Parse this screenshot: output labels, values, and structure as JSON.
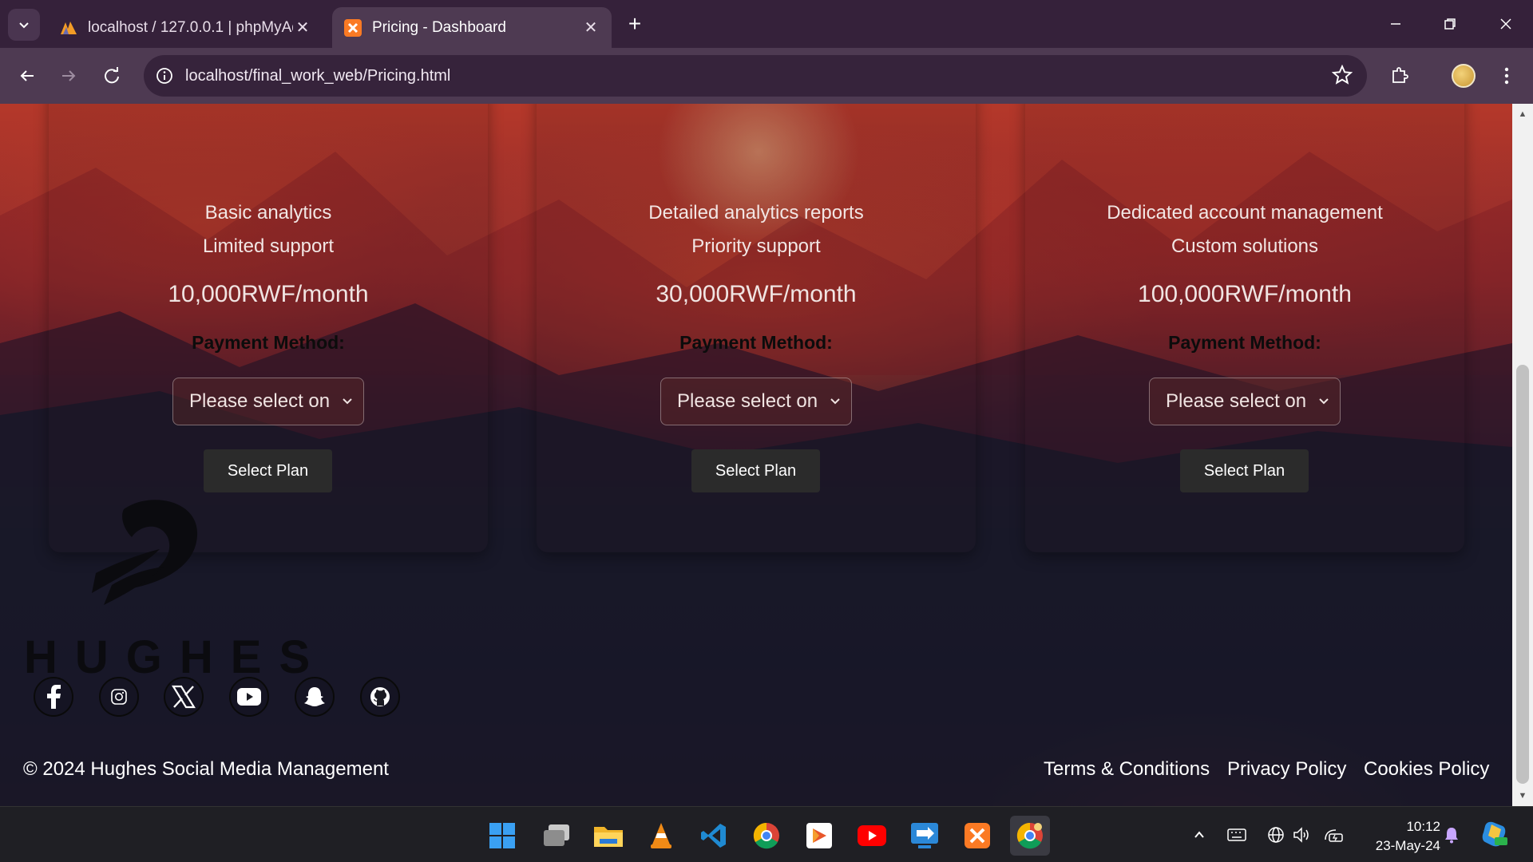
{
  "browser": {
    "tabs": [
      {
        "title": "localhost / 127.0.0.1 | phpMyAd",
        "active": false
      },
      {
        "title": "Pricing - Dashboard",
        "active": true
      }
    ],
    "url": "localhost/final_work_web/Pricing.html"
  },
  "plans": [
    {
      "features": [
        "Basic analytics",
        "Limited support"
      ],
      "price": "10,000RWF/month",
      "payment_label": "Payment Method:",
      "select_value": "Please select on",
      "button": "Select Plan"
    },
    {
      "features": [
        "Detailed analytics reports",
        "Priority support"
      ],
      "price": "30,000RWF/month",
      "payment_label": "Payment Method:",
      "select_value": "Please select on",
      "button": "Select Plan"
    },
    {
      "features": [
        "Dedicated account management",
        "Custom solutions"
      ],
      "price": "100,000RWF/month",
      "payment_label": "Payment Method:",
      "select_value": "Please select on",
      "button": "Select Plan"
    }
  ],
  "footer": {
    "brand": "HUGHES",
    "social": [
      "facebook-icon",
      "instagram-icon",
      "x-icon",
      "youtube-icon",
      "snapchat-icon",
      "github-icon"
    ],
    "copyright": "© 2024 Hughes Social Media Management",
    "links": [
      "Terms & Conditions",
      "Privacy Policy",
      "Cookies Policy"
    ]
  },
  "taskbar": {
    "apps": [
      "windows-start-icon",
      "task-view-icon",
      "file-explorer-icon",
      "vlc-icon",
      "vscode-icon",
      "chrome-icon",
      "media-player-icon",
      "youtube-icon",
      "remote-desktop-icon",
      "xampp-icon",
      "chrome-profile-icon"
    ],
    "time": "10:12",
    "date": "23-May-24"
  },
  "colors": {
    "accent": "#35213a",
    "button_bg": "#2b2b2b"
  }
}
